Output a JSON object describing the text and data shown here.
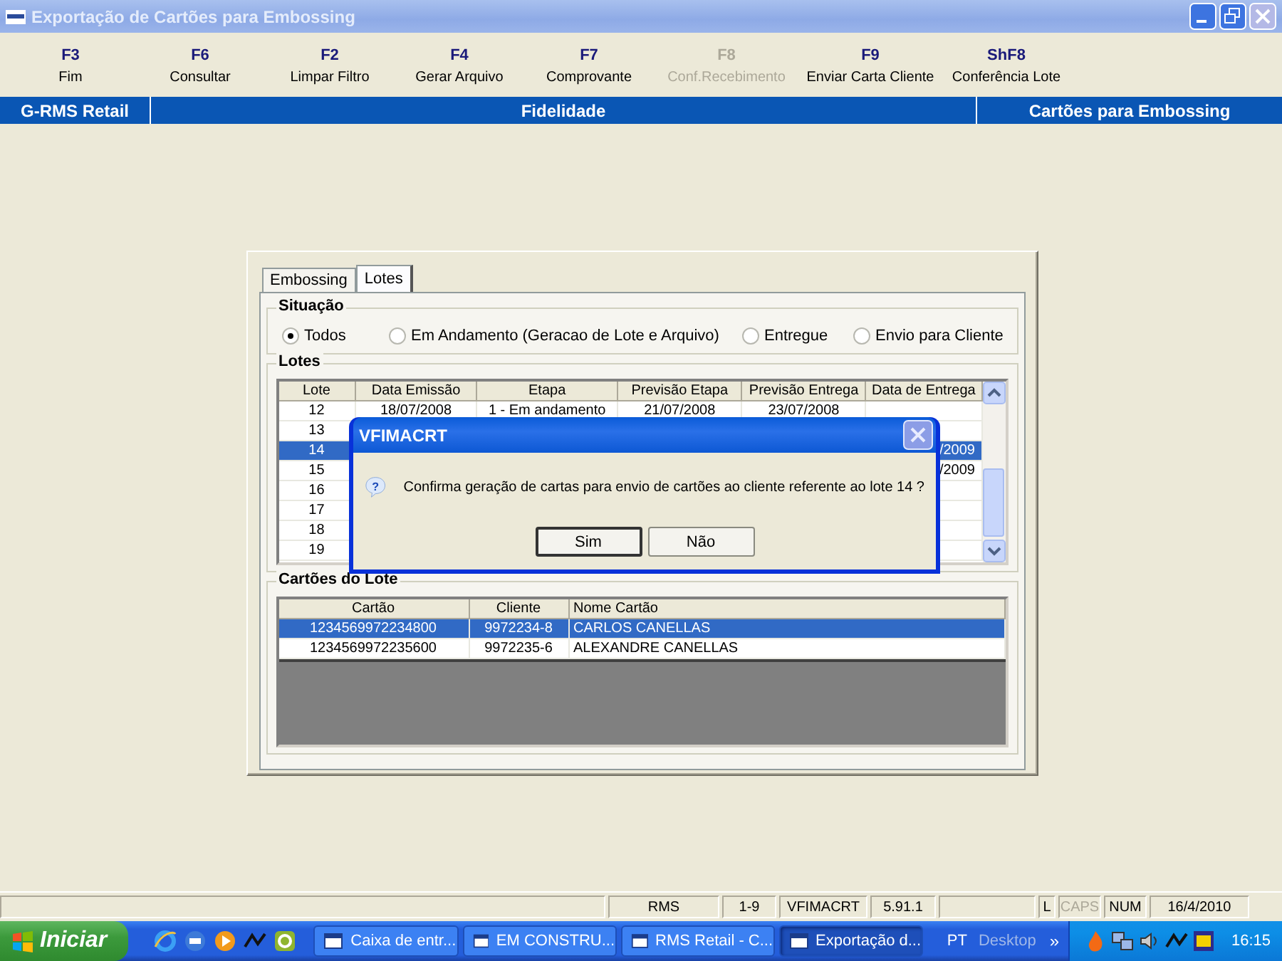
{
  "window": {
    "title": "Exportação de Cartões para Embossing"
  },
  "toolbar": [
    {
      "key": "F3",
      "label": "Fim",
      "disabled": false
    },
    {
      "key": "F6",
      "label": "Consultar",
      "disabled": false
    },
    {
      "key": "F2",
      "label": "Limpar Filtro",
      "disabled": false
    },
    {
      "key": "F4",
      "label": "Gerar Arquivo",
      "disabled": false
    },
    {
      "key": "F7",
      "label": "Comprovante",
      "disabled": false
    },
    {
      "key": "F8",
      "label": "Conf.Recebimento",
      "disabled": true
    },
    {
      "key": "F9",
      "label": "Enviar Carta Cliente",
      "disabled": false
    },
    {
      "key": "ShF8",
      "label": "Conferência Lote",
      "disabled": false
    }
  ],
  "header_bar": [
    "G-RMS Retail",
    "Fidelidade",
    "Cartões para Embossing"
  ],
  "tabs": [
    {
      "label": "Embossing",
      "selected": false
    },
    {
      "label": "Lotes",
      "selected": true
    }
  ],
  "situacao": {
    "title": "Situação",
    "options": [
      {
        "label": "Todos",
        "selected": true
      },
      {
        "label": "Em Andamento (Geracao de Lote e Arquivo)",
        "selected": false
      },
      {
        "label": "Entregue",
        "selected": false
      },
      {
        "label": "Envio para Cliente",
        "selected": false
      }
    ]
  },
  "lotes": {
    "title": "Lotes",
    "columns": [
      "Lote",
      "Data Emissão",
      "Etapa",
      "Previsão Etapa",
      "Previsão Entrega",
      "Data de Entrega"
    ],
    "rows": [
      {
        "cells": [
          "12",
          "18/07/2008",
          "1 - Em andamento",
          "21/07/2008",
          "23/07/2008",
          null
        ],
        "selected": false
      },
      {
        "cells": [
          "13",
          null,
          null,
          null,
          null,
          null
        ],
        "selected": false
      },
      {
        "cells": [
          "14",
          null,
          null,
          null,
          null,
          "/2009"
        ],
        "selected": true
      },
      {
        "cells": [
          "15",
          null,
          null,
          null,
          null,
          "/2009"
        ],
        "selected": false
      },
      {
        "cells": [
          "16",
          null,
          null,
          null,
          null,
          null
        ],
        "selected": false
      },
      {
        "cells": [
          "17",
          null,
          null,
          null,
          null,
          null
        ],
        "selected": false
      },
      {
        "cells": [
          "18",
          null,
          null,
          null,
          null,
          null
        ],
        "selected": false
      },
      {
        "cells": [
          "19",
          null,
          null,
          null,
          null,
          null
        ],
        "selected": false
      }
    ]
  },
  "cartoes": {
    "title": "Cartões do Lote",
    "columns": [
      "Cartão",
      "Cliente",
      "Nome Cartão"
    ],
    "rows": [
      {
        "cells": [
          "1234569972234800",
          "9972234-8",
          "CARLOS CANELLAS"
        ],
        "selected": true
      },
      {
        "cells": [
          "1234569972235600",
          "9972235-6",
          "ALEXANDRE CANELLAS"
        ],
        "selected": false
      }
    ]
  },
  "dialog": {
    "title": "VFIMACRT",
    "icon_glyph": "?",
    "message": "Confirma geração de cartas para envio de cartões ao cliente referente ao lote 14 ?",
    "buttons": [
      {
        "label": "Sim",
        "focused": true
      },
      {
        "label": "Não",
        "focused": false
      }
    ]
  },
  "status_bar": [
    {
      "kind": "blank"
    },
    {
      "kind": "text",
      "text": "RMS",
      "disabled": false
    },
    {
      "kind": "text",
      "text": "1-9",
      "disabled": false
    },
    {
      "kind": "text",
      "text": "VFIMACRT",
      "disabled": false
    },
    {
      "kind": "text",
      "text": "5.91.1",
      "disabled": false
    },
    {
      "kind": "blank"
    },
    {
      "kind": "text",
      "text": "L",
      "disabled": false
    },
    {
      "kind": "text",
      "text": "CAPS",
      "disabled": true
    },
    {
      "kind": "text",
      "text": "NUM",
      "disabled": false
    },
    {
      "kind": "text",
      "text": "16/4/2010",
      "disabled": false
    }
  ],
  "taskbar": {
    "start": "Iniciar",
    "tasks": [
      {
        "label": "Caixa de entr...",
        "selected": false
      },
      {
        "label": "EM CONSTRU...",
        "selected": false
      },
      {
        "label": "RMS Retail - C...",
        "selected": false
      },
      {
        "label": "Exportação d...",
        "selected": true
      }
    ],
    "language": "PT",
    "desktop": "Desktop",
    "more": "»",
    "time": "16:15"
  }
}
